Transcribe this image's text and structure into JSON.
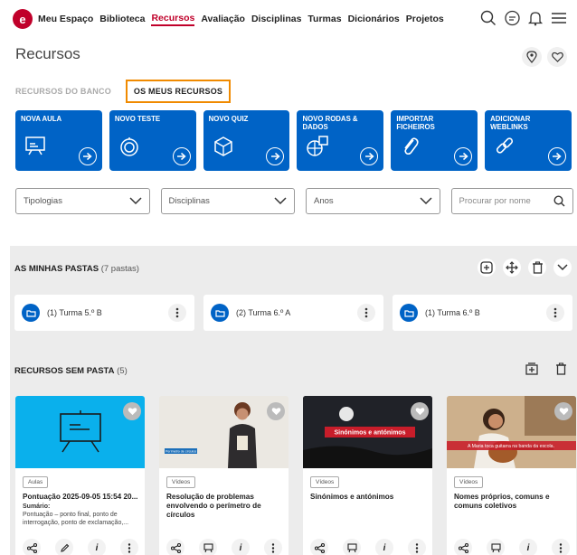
{
  "nav": {
    "items": [
      "Meu Espaço",
      "Biblioteca",
      "Recursos",
      "Avaliação",
      "Disciplinas",
      "Turmas",
      "Dicionários",
      "Projetos"
    ],
    "active": "Recursos",
    "icons": [
      "search-icon",
      "chat-icon",
      "bell-icon",
      "menu-icon"
    ]
  },
  "header": {
    "title": "Recursos",
    "icons": [
      "location-pin-icon",
      "heart-icon"
    ]
  },
  "tabs": {
    "bank": "RECURSOS DO BANCO",
    "mine": "OS MEUS RECURSOS"
  },
  "actions": [
    {
      "label": "NOVA AULA",
      "icon": "presentation-icon"
    },
    {
      "label": "NOVO TESTE",
      "icon": "stopwatch-icon"
    },
    {
      "label": "NOVO QUIZ",
      "icon": "cube-icon"
    },
    {
      "label": "NOVO RODAS & DADOS",
      "icon": "wheel-dice-icon"
    },
    {
      "label": "IMPORTAR FICHEIROS",
      "icon": "paperclip-icon"
    },
    {
      "label": "ADICIONAR WEBLINKS",
      "icon": "link-icon"
    }
  ],
  "filters": {
    "tipologias": "Tipologias",
    "disciplinas": "Disciplinas",
    "anos": "Anos",
    "search_placeholder": "Procurar por nome"
  },
  "folders": {
    "title": "AS MINHAS PASTAS",
    "count": "(7 pastas)",
    "items": [
      "(1) Turma 5.º B",
      "(2) Turma 6.º A",
      "(1) Turma 6.º B"
    ]
  },
  "resources": {
    "title": "RECURSOS SEM PASTA",
    "count": "(5)",
    "cards": [
      {
        "type": "Aulas",
        "title": "Pontuação 2025-09-05 15:54 20...",
        "sub_label": "Sumário:",
        "sub": "Pontuação – ponto final, ponto de interrogação, ponto de exclamação,..."
      },
      {
        "type": "Vídeos",
        "title": "Resolução de problemas envolvendo o perímetro de círculos",
        "overlay": "Perímetro de círculos"
      },
      {
        "type": "Vídeos",
        "title": "Sinónimos e antónimos",
        "overlay": "Sinónimos e antónimos"
      },
      {
        "type": "Vídeos",
        "title": "Nomes próprios, comuns e comuns coletivos",
        "overlay": "A Maria toca guitarra na banda da escola."
      }
    ]
  },
  "colors": {
    "brand": "#c0002a",
    "primary": "#0063c6",
    "tab_highlight": "#f08a00"
  }
}
